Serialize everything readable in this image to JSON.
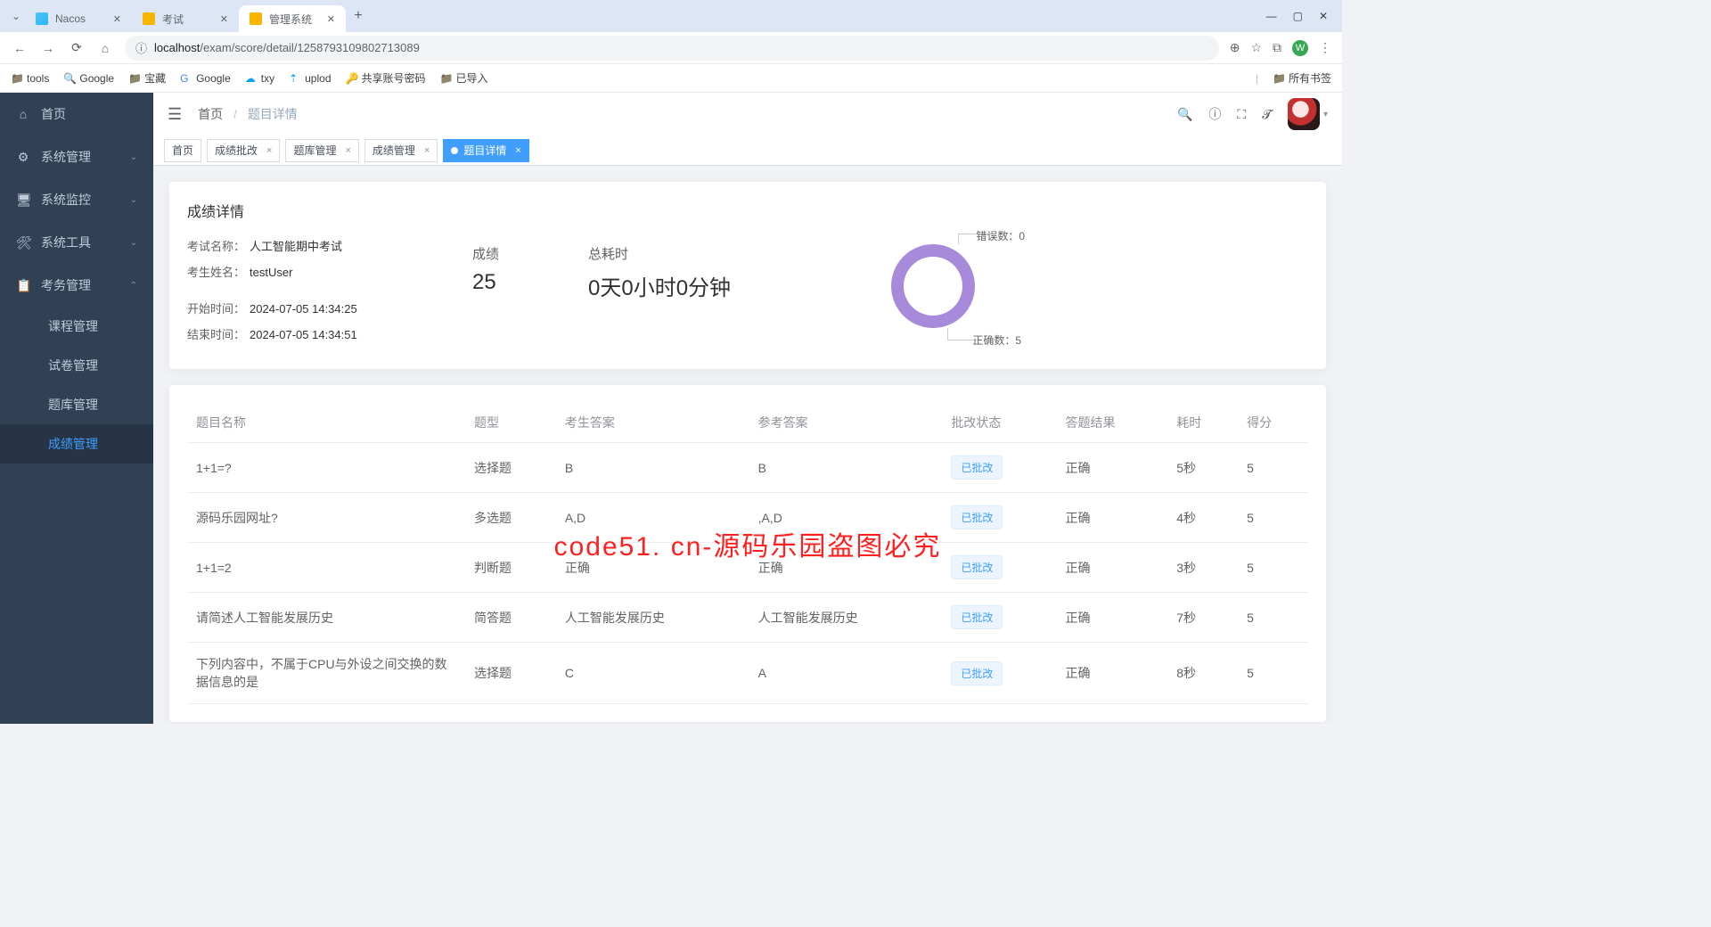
{
  "browser": {
    "tabs": [
      {
        "title": "Nacos",
        "active": false
      },
      {
        "title": "考试",
        "active": false
      },
      {
        "title": "管理系统",
        "active": true
      }
    ],
    "url_host": "localhost",
    "url_path": "/exam/score/detail/1258793109802713089",
    "bookmarks": [
      "tools",
      "Google",
      "宝藏",
      "Google",
      "txy",
      "uplod",
      "共享账号密码",
      "已导入"
    ],
    "all_bookmarks": "所有书签",
    "profile_letter": "W"
  },
  "sidebar": {
    "items": [
      {
        "label": "首页",
        "icon": "🏠"
      },
      {
        "label": "系统管理",
        "icon": "⚙",
        "exp": true
      },
      {
        "label": "系统监控",
        "icon": "🖥",
        "exp": true
      },
      {
        "label": "系统工具",
        "icon": "🛠",
        "exp": true
      },
      {
        "label": "考务管理",
        "icon": "📋",
        "exp": true,
        "open": true
      }
    ],
    "subitems": [
      "课程管理",
      "试卷管理",
      "题库管理",
      "成绩管理"
    ],
    "active_sub": 3
  },
  "breadcrumb": {
    "home": "首页",
    "current": "题目详情"
  },
  "view_tabs": [
    {
      "label": "首页",
      "closable": false
    },
    {
      "label": "成绩批改",
      "closable": true
    },
    {
      "label": "题库管理",
      "closable": true
    },
    {
      "label": "成绩管理",
      "closable": true
    },
    {
      "label": "题目详情",
      "closable": true,
      "active": true
    }
  ],
  "detail": {
    "title": "成绩详情",
    "exam_name_lbl": "考试名称：",
    "exam_name": "人工智能期中考试",
    "user_lbl": "考生姓名：",
    "user": "testUser",
    "start_lbl": "开始时间：",
    "start": "2024-07-05 14:34:25",
    "end_lbl": "结束时间：",
    "end": "2024-07-05 14:34:51",
    "score_lbl": "成绩",
    "score": "25",
    "duration_lbl": "总耗时",
    "duration": "0天0小时0分钟"
  },
  "chart_data": {
    "type": "pie",
    "title": "",
    "series": [
      {
        "name": "错误数",
        "value": 0,
        "color": "#e6a23c"
      },
      {
        "name": "正确数",
        "value": 5,
        "color": "#a78bda"
      }
    ],
    "labels": {
      "wrong": "错误数：0",
      "correct": "正确数：5"
    }
  },
  "table": {
    "headers": [
      "题目名称",
      "题型",
      "考生答案",
      "参考答案",
      "批改状态",
      "答题结果",
      "耗时",
      "得分"
    ],
    "status_tag": "已批改",
    "rows": [
      {
        "name": "1+1=?",
        "type": "选择题",
        "ans": "B",
        "ref": "B",
        "result": "正确",
        "dur": "5秒",
        "score": "5"
      },
      {
        "name": "源码乐园网址?",
        "type": "多选题",
        "ans": "A,D",
        "ref": ",A,D",
        "result": "正确",
        "dur": "4秒",
        "score": "5"
      },
      {
        "name": "1+1=2",
        "type": "判断题",
        "ans": "正确",
        "ref": "正确",
        "result": "正确",
        "dur": "3秒",
        "score": "5"
      },
      {
        "name": "请简述人工智能发展历史",
        "type": "简答题",
        "ans": "人工智能发展历史",
        "ref": "人工智能发展历史",
        "result": "正确",
        "dur": "7秒",
        "score": "5"
      },
      {
        "name": "下列内容中，不属于CPU与外设之间交换的数据信息的是",
        "type": "选择题",
        "ans": "C",
        "ref": "A",
        "result": "正确",
        "dur": "8秒",
        "score": "5"
      }
    ]
  },
  "watermark": "code51. cn-源码乐园盗图必究"
}
